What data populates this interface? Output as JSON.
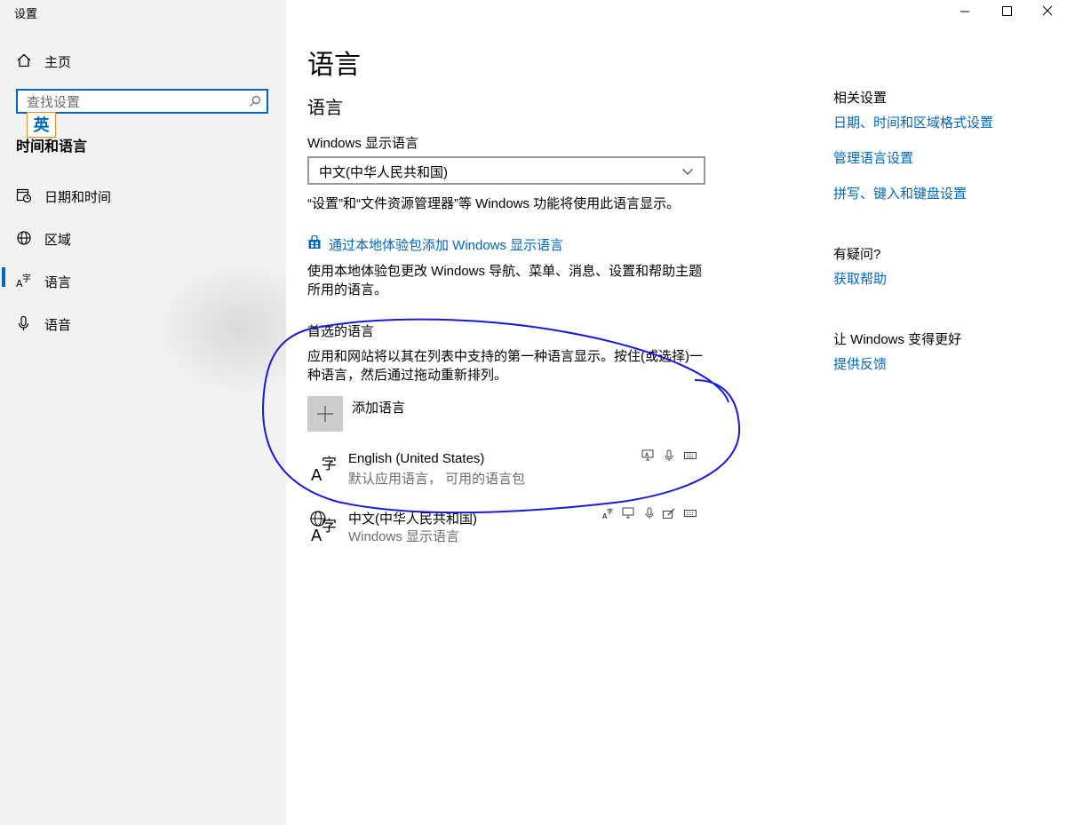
{
  "window": {
    "title": "设置",
    "controls": {
      "minimize": "—",
      "maximize": "☐",
      "close": "✕"
    }
  },
  "sidebar": {
    "home_label": "主页",
    "search_placeholder": "查找设置",
    "ime_indicator": "英",
    "section_title": "时间和语言",
    "items": [
      {
        "label": "日期和时间",
        "icon": "clock-calendar-icon"
      },
      {
        "label": "区域",
        "icon": "globe-icon"
      },
      {
        "label": "语言",
        "icon": "language-icon",
        "active": true
      },
      {
        "label": "语音",
        "icon": "microphone-icon"
      }
    ]
  },
  "main": {
    "page_title": "语言",
    "subtitle": "语言",
    "display_language": {
      "label": "Windows 显示语言",
      "value": "中文(中华人民共和国)",
      "note": "“设置”和“文件资源管理器”等 Windows 功能将使用此语言显示。"
    },
    "store_link": "通过本地体验包添加 Windows 显示语言",
    "store_note_line1": "使用本地体验包更改 Windows 导航、菜单、消息、设置和帮助主题",
    "store_note_line2": "所用的语言。",
    "preferred": {
      "heading": "首选的语言",
      "desc_line1": "应用和网站将以其在列表中支持的第一种语言显示。按住(或选择)一",
      "desc_line2": "种语言，然后通过拖动重新排列。",
      "add_label": "添加语言",
      "languages": [
        {
          "name": "English (United States)",
          "desc": "默认应用语言， 可用的语言包"
        },
        {
          "name": "中文(中华人民共和国)",
          "desc": "Windows 显示语言"
        }
      ]
    }
  },
  "right": {
    "related_heading": "相关设置",
    "related_links": [
      "日期、时间和区域格式设置",
      "管理语言设置",
      "拼写、键入和键盘设置"
    ],
    "question_heading": "有疑问?",
    "help_link": "获取帮助",
    "feedback_heading": "让 Windows 变得更好",
    "feedback_link": "提供反馈"
  },
  "colors": {
    "accent": "#0067c0",
    "annotation": "#1a1ad6",
    "sidebar_bg": "#f2f2f2"
  }
}
